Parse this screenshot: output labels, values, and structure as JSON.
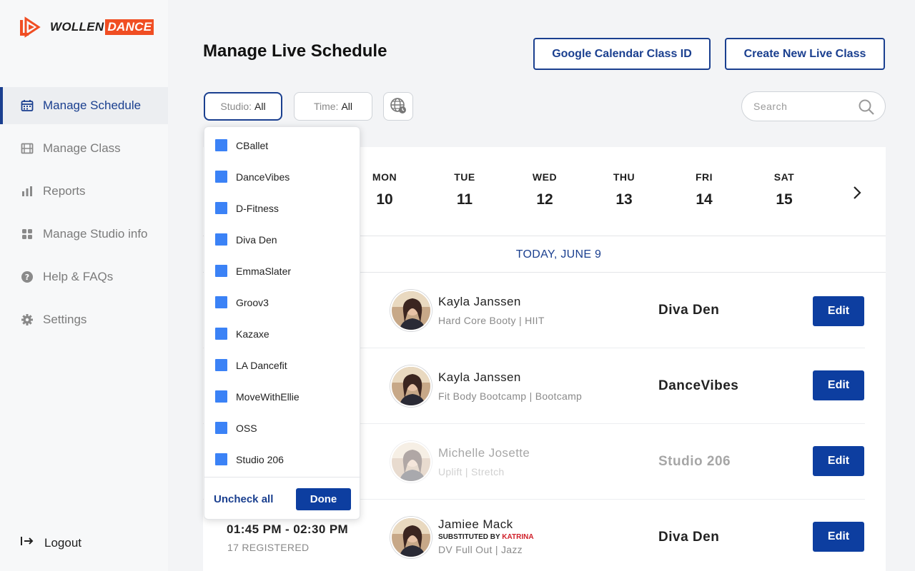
{
  "brand": {
    "logo_word1": "WOLLEN",
    "logo_word2": "DANCE",
    "accent": "#f04e23",
    "primary": "#1a3f8f"
  },
  "sidebar": {
    "items": [
      {
        "label": "Manage Schedule",
        "icon": "calendar-icon",
        "active": true
      },
      {
        "label": "Manage Class",
        "icon": "film-icon",
        "active": false
      },
      {
        "label": "Reports",
        "icon": "bar-chart-icon",
        "active": false
      },
      {
        "label": "Manage Studio info",
        "icon": "grid-icon",
        "active": false
      },
      {
        "label": "Help & FAQs",
        "icon": "question-icon",
        "active": false
      },
      {
        "label": "Settings",
        "icon": "gear-icon",
        "active": false
      }
    ],
    "logout_label": "Logout"
  },
  "header": {
    "title": "Manage Live Schedule",
    "gcal_button": "Google Calendar Class ID",
    "create_button": "Create New Live Class"
  },
  "filters": {
    "studio_label": "Studio:",
    "studio_value": "All",
    "time_label": "Time:",
    "time_value": "All",
    "search_placeholder": "Search"
  },
  "week": {
    "days": [
      {
        "name": "MON",
        "date": "10"
      },
      {
        "name": "TUE",
        "date": "11"
      },
      {
        "name": "WED",
        "date": "12"
      },
      {
        "name": "THU",
        "date": "13"
      },
      {
        "name": "FRI",
        "date": "14"
      },
      {
        "name": "SAT",
        "date": "15"
      }
    ],
    "today_label": "TODAY, JUNE 9"
  },
  "classes": [
    {
      "instructor": "Kayla Janssen",
      "class": "Hard Core Booty | HIIT",
      "studio": "Diva Den",
      "edit": "Edit",
      "faded": false
    },
    {
      "instructor": "Kayla Janssen",
      "class": "Fit Body Bootcamp | Bootcamp",
      "studio": "DanceVibes",
      "edit": "Edit",
      "faded": false
    },
    {
      "instructor": "Michelle Josette",
      "class": "Uplift | Stretch",
      "studio": "Studio 206",
      "edit": "Edit",
      "faded": true
    },
    {
      "instructor": "Jamiee Mack",
      "substituted_prefix": "SUBSTITUTED BY",
      "substituted_name": "KATRINA",
      "class": "DV Full Out | Jazz",
      "studio": "Diva Den",
      "edit": "Edit",
      "faded": false,
      "time": "01:45 PM - 02:30 PM",
      "registered": "17 REGISTERED"
    }
  ],
  "studio_dropdown": {
    "options": [
      "CBallet",
      "DanceVibes",
      "D-Fitness",
      "Diva Den",
      "EmmaSlater",
      "Groov3",
      "Kazaxe",
      "LA Dancefit",
      "MoveWithEllie",
      "OSS",
      "Studio 206"
    ],
    "uncheck_all": "Uncheck all",
    "done": "Done"
  }
}
